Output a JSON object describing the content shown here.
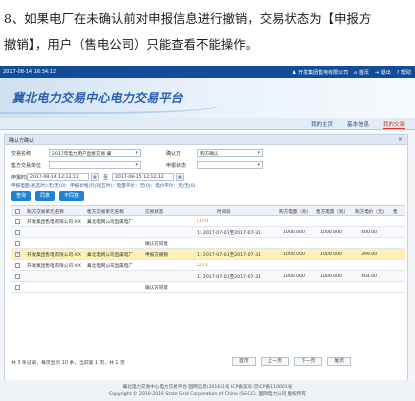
{
  "doc": {
    "line1": "8、如果电厂在未确认前对申报信息进行撤销，交易状态为【申报方",
    "line2": "撤销】，用户（售电公司）只能查看不能操作。"
  },
  "topbar": {
    "time": "2017-08-14 16:34:12",
    "user": "开发集团售电有限公司",
    "home": "首页",
    "logout": "退出",
    "help": "帮助"
  },
  "banner": {
    "title": "冀北电力交易中心电力交易平台"
  },
  "nav": {
    "items": [
      "我的主页",
      "基本信息",
      "我的交易"
    ],
    "active_index": 2
  },
  "panel": {
    "title": "确认方确认"
  },
  "form": {
    "trade_name_label": "交易名称",
    "trade_name_value": "2017年电力用户直接交易-冀",
    "confirmer_label": "确认方",
    "confirmer_value": "购方确认",
    "sell_unit_label": "售方交易单位",
    "sell_unit_value": "",
    "status_label": "申报状态",
    "status_value": "",
    "time_label": "申报时间",
    "time_from": "2017-08-14 12:12:12",
    "to_label": "至",
    "time_to": "2017-08-15 12:12:12",
    "info": "申报电量(兆瓦时):无/无(0)：申报价格(元/兆瓦时)：电量平价：无(0)：电价平价：无/无(0)"
  },
  "buttons": {
    "query": "查询",
    "confirm": "同意",
    "reject": "不同意"
  },
  "table": {
    "headers": [
      "购方交易单元名称",
      "售方交易单元名称",
      "交易状态",
      "时间段",
      "购方电量（兆）",
      "售方电量（兆）",
      "购方电价（元）",
      "售"
    ],
    "rows": [
      {
        "buyer": "开发集团售电有限公司-XX",
        "seller": "冀北电网公司直属电厂",
        "status": "",
        "period": "[1]-0",
        "qb": "",
        "qs": "",
        "pb": "",
        "checked": false,
        "style": "normal"
      },
      {
        "buyer": "",
        "seller": "",
        "status": "",
        "period": "1: 2017-07-01至2017-07-31",
        "qb": "1000.000",
        "qs": "1000.000",
        "pb": "400.00",
        "checked": false,
        "style": "alt"
      },
      {
        "buyer": "",
        "seller": "",
        "status": "确认方同意",
        "period": "",
        "qb": "",
        "qs": "",
        "pb": "",
        "checked": false,
        "style": "normal"
      },
      {
        "buyer": "开发集团售电有限公司-XX",
        "seller": "冀北电网公司直属电厂",
        "status": "申报方撤销",
        "period": "1: 2017-07-01至2017-07-31",
        "qb": "1000.000",
        "qs": "1000.000",
        "pb": "399.00",
        "checked": true,
        "style": "sel"
      },
      {
        "buyer": "开发集团售电有限公司-XX",
        "seller": "冀北电网公司直属电厂",
        "status": "",
        "period": "[2]-1",
        "qb": "",
        "qs": "",
        "pb": "",
        "checked": false,
        "style": "normal"
      },
      {
        "buyer": "",
        "seller": "",
        "status": "",
        "period": "1: 2017-07-01至2017-07-31",
        "qb": "1000.000",
        "qs": "1000.000",
        "pb": "404.00",
        "checked": false,
        "style": "alt"
      },
      {
        "buyer": "",
        "seller": "",
        "status": "确认方同意",
        "period": "",
        "qb": "",
        "qs": "",
        "pb": "",
        "checked": false,
        "style": "normal"
      }
    ]
  },
  "pager": {
    "summary": "共 3 条记录，每页显示 10 条，当前第 1 页，共 1 页",
    "first": "首页",
    "prev": "上一页",
    "next": "下一页",
    "last": "尾页"
  },
  "footer": {
    "line1": "冀北电力交易中心电力交易平台  国网信息(2016)1号  ICP备案号:京ICP备110001号",
    "line2": "Copyright © 2010-2016 State Grid Corporation of China (SGCC). 国网电力公司 版权所有"
  }
}
